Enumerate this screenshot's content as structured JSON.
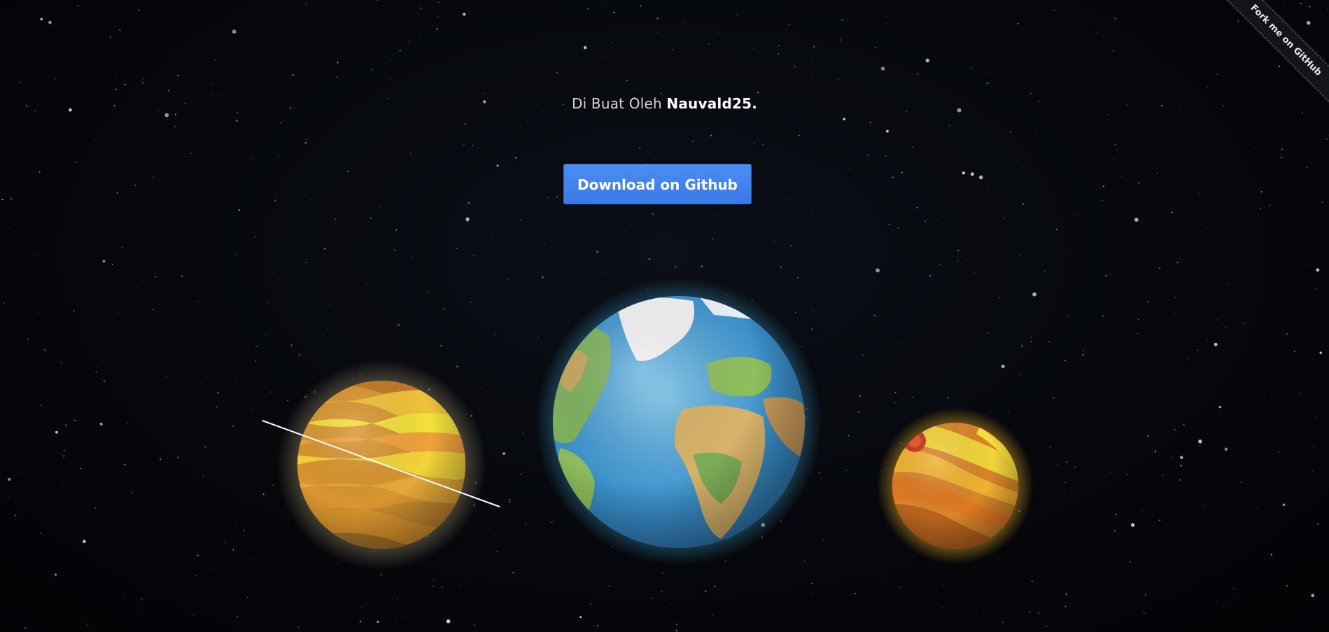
{
  "credit": {
    "prefix": "Di Buat Oleh",
    "author": "Nauvald25."
  },
  "download_button": {
    "label": "Download on Github"
  },
  "ribbon": {
    "label": "Fork me on GitHub"
  },
  "colors": {
    "background": "#05070b",
    "button": "#4a8df6",
    "ocean": "#3a8fc9",
    "gas_giant_light": "#f2d43a",
    "gas_giant_dark": "#d88a2a",
    "small_planet_red": "#c8361e"
  }
}
